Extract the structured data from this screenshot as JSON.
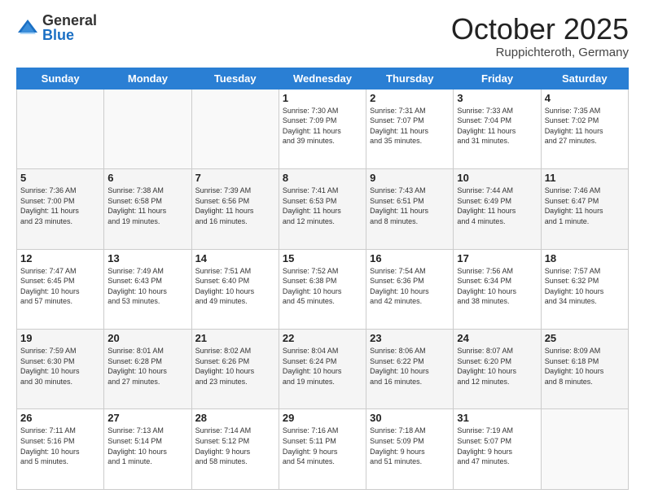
{
  "header": {
    "logo_general": "General",
    "logo_blue": "Blue",
    "month": "October 2025",
    "location": "Ruppichteroth, Germany"
  },
  "weekdays": [
    "Sunday",
    "Monday",
    "Tuesday",
    "Wednesday",
    "Thursday",
    "Friday",
    "Saturday"
  ],
  "weeks": [
    [
      {
        "day": "",
        "info": ""
      },
      {
        "day": "",
        "info": ""
      },
      {
        "day": "",
        "info": ""
      },
      {
        "day": "1",
        "info": "Sunrise: 7:30 AM\nSunset: 7:09 PM\nDaylight: 11 hours\nand 39 minutes."
      },
      {
        "day": "2",
        "info": "Sunrise: 7:31 AM\nSunset: 7:07 PM\nDaylight: 11 hours\nand 35 minutes."
      },
      {
        "day": "3",
        "info": "Sunrise: 7:33 AM\nSunset: 7:04 PM\nDaylight: 11 hours\nand 31 minutes."
      },
      {
        "day": "4",
        "info": "Sunrise: 7:35 AM\nSunset: 7:02 PM\nDaylight: 11 hours\nand 27 minutes."
      }
    ],
    [
      {
        "day": "5",
        "info": "Sunrise: 7:36 AM\nSunset: 7:00 PM\nDaylight: 11 hours\nand 23 minutes."
      },
      {
        "day": "6",
        "info": "Sunrise: 7:38 AM\nSunset: 6:58 PM\nDaylight: 11 hours\nand 19 minutes."
      },
      {
        "day": "7",
        "info": "Sunrise: 7:39 AM\nSunset: 6:56 PM\nDaylight: 11 hours\nand 16 minutes."
      },
      {
        "day": "8",
        "info": "Sunrise: 7:41 AM\nSunset: 6:53 PM\nDaylight: 11 hours\nand 12 minutes."
      },
      {
        "day": "9",
        "info": "Sunrise: 7:43 AM\nSunset: 6:51 PM\nDaylight: 11 hours\nand 8 minutes."
      },
      {
        "day": "10",
        "info": "Sunrise: 7:44 AM\nSunset: 6:49 PM\nDaylight: 11 hours\nand 4 minutes."
      },
      {
        "day": "11",
        "info": "Sunrise: 7:46 AM\nSunset: 6:47 PM\nDaylight: 11 hours\nand 1 minute."
      }
    ],
    [
      {
        "day": "12",
        "info": "Sunrise: 7:47 AM\nSunset: 6:45 PM\nDaylight: 10 hours\nand 57 minutes."
      },
      {
        "day": "13",
        "info": "Sunrise: 7:49 AM\nSunset: 6:43 PM\nDaylight: 10 hours\nand 53 minutes."
      },
      {
        "day": "14",
        "info": "Sunrise: 7:51 AM\nSunset: 6:40 PM\nDaylight: 10 hours\nand 49 minutes."
      },
      {
        "day": "15",
        "info": "Sunrise: 7:52 AM\nSunset: 6:38 PM\nDaylight: 10 hours\nand 45 minutes."
      },
      {
        "day": "16",
        "info": "Sunrise: 7:54 AM\nSunset: 6:36 PM\nDaylight: 10 hours\nand 42 minutes."
      },
      {
        "day": "17",
        "info": "Sunrise: 7:56 AM\nSunset: 6:34 PM\nDaylight: 10 hours\nand 38 minutes."
      },
      {
        "day": "18",
        "info": "Sunrise: 7:57 AM\nSunset: 6:32 PM\nDaylight: 10 hours\nand 34 minutes."
      }
    ],
    [
      {
        "day": "19",
        "info": "Sunrise: 7:59 AM\nSunset: 6:30 PM\nDaylight: 10 hours\nand 30 minutes."
      },
      {
        "day": "20",
        "info": "Sunrise: 8:01 AM\nSunset: 6:28 PM\nDaylight: 10 hours\nand 27 minutes."
      },
      {
        "day": "21",
        "info": "Sunrise: 8:02 AM\nSunset: 6:26 PM\nDaylight: 10 hours\nand 23 minutes."
      },
      {
        "day": "22",
        "info": "Sunrise: 8:04 AM\nSunset: 6:24 PM\nDaylight: 10 hours\nand 19 minutes."
      },
      {
        "day": "23",
        "info": "Sunrise: 8:06 AM\nSunset: 6:22 PM\nDaylight: 10 hours\nand 16 minutes."
      },
      {
        "day": "24",
        "info": "Sunrise: 8:07 AM\nSunset: 6:20 PM\nDaylight: 10 hours\nand 12 minutes."
      },
      {
        "day": "25",
        "info": "Sunrise: 8:09 AM\nSunset: 6:18 PM\nDaylight: 10 hours\nand 8 minutes."
      }
    ],
    [
      {
        "day": "26",
        "info": "Sunrise: 7:11 AM\nSunset: 5:16 PM\nDaylight: 10 hours\nand 5 minutes."
      },
      {
        "day": "27",
        "info": "Sunrise: 7:13 AM\nSunset: 5:14 PM\nDaylight: 10 hours\nand 1 minute."
      },
      {
        "day": "28",
        "info": "Sunrise: 7:14 AM\nSunset: 5:12 PM\nDaylight: 9 hours\nand 58 minutes."
      },
      {
        "day": "29",
        "info": "Sunrise: 7:16 AM\nSunset: 5:11 PM\nDaylight: 9 hours\nand 54 minutes."
      },
      {
        "day": "30",
        "info": "Sunrise: 7:18 AM\nSunset: 5:09 PM\nDaylight: 9 hours\nand 51 minutes."
      },
      {
        "day": "31",
        "info": "Sunrise: 7:19 AM\nSunset: 5:07 PM\nDaylight: 9 hours\nand 47 minutes."
      },
      {
        "day": "",
        "info": ""
      }
    ]
  ]
}
